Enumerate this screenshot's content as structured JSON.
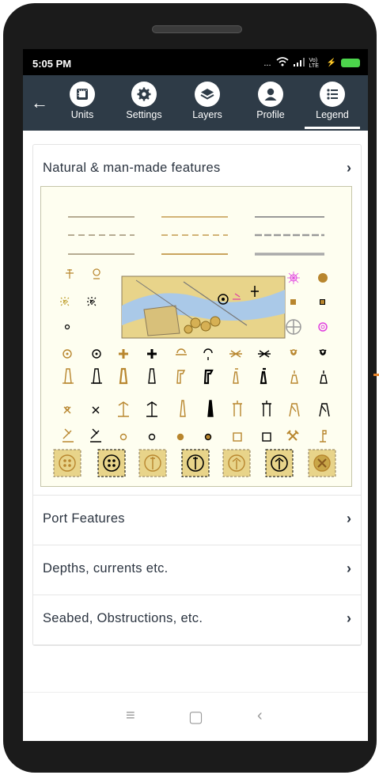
{
  "status": {
    "time": "5:05 PM",
    "signal_text": "...",
    "lte": "Vo) LTE"
  },
  "toolbar": {
    "back_icon": "arrow-left-icon",
    "items": [
      {
        "label": "Units",
        "icon": "ruler-icon"
      },
      {
        "label": "Settings",
        "icon": "gear-icon"
      },
      {
        "label": "Layers",
        "icon": "layers-icon"
      },
      {
        "label": "Profile",
        "icon": "person-icon"
      },
      {
        "label": "Legend",
        "icon": "list-icon",
        "active": true
      }
    ]
  },
  "sections": [
    {
      "label": "Natural & man-made features",
      "expanded": true
    },
    {
      "label": "Port Features"
    },
    {
      "label": "Depths, currents etc."
    },
    {
      "label": "Seabed, Obstructions, etc."
    }
  ],
  "nav": {
    "menu": "≡",
    "home": "▢",
    "back": "‹"
  },
  "colors": {
    "toolbar": "#2e3b47",
    "legend_bg": "#fefef0",
    "chart_brown": "#b8862e",
    "chart_sand": "#e8d48a"
  }
}
